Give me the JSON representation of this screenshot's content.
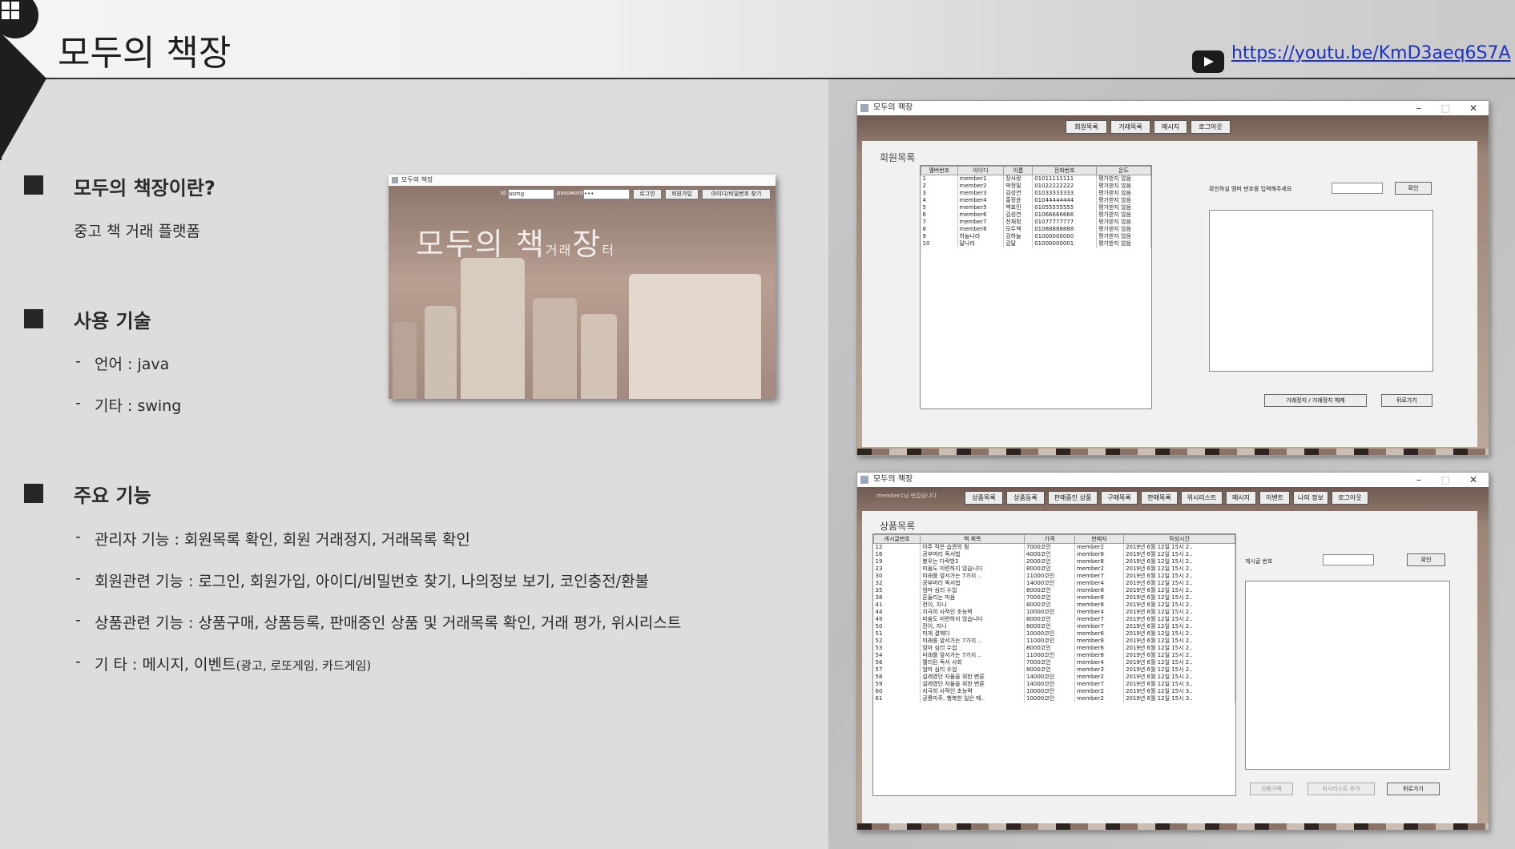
{
  "header": {
    "title": "모두의 책장",
    "youtube_link": "https://youtu.be/KmD3aeq6S7A"
  },
  "sections": {
    "about": {
      "title": "모두의 책장이란?",
      "desc": "중고 책 거래 플랫폼"
    },
    "tech": {
      "title": "사용 기술",
      "items": [
        "언어 : java",
        "기타 : swing"
      ]
    },
    "features": {
      "title": "주요 기능",
      "items": [
        "관리자 기능 : 회원목록 확인, 회원 거래정지, 거래목록 확인",
        "회원관련 기능 : 로그인, 회원가입, 아이디/비밀번호 찾기, 나의정보 보기, 코인충전/환불",
        "상품관련 기능 : 상품구매, 상품등록, 판매중인 상품 및 거래목록 확인, 거래 평가, 위시리스트"
      ],
      "etc_main": "기 타 : 메시지, 이벤트",
      "etc_small": "(광고, 로또게임, 카드게임)"
    }
  },
  "login_window": {
    "window_title": "모두의 책장",
    "id_label": "id",
    "id_value": "asmg",
    "pw_label": "password",
    "pw_value": "•••",
    "login_btn": "로그인",
    "signup_btn": "회원가입",
    "find_btn": "아이디/비밀번호 찾기",
    "title_main": "모두의 책",
    "title_small1": "거래",
    "title_main2": "장",
    "title_small2": "터"
  },
  "admin_window": {
    "window_title": "모두의 책장",
    "buttons": [
      "회원목록",
      "거래목록",
      "메시지",
      "로그아웃"
    ],
    "panel_title": "회원목록",
    "columns": [
      "멤버번호",
      "아이디",
      "이름",
      "전화번호",
      "온도"
    ],
    "rows": [
      [
        "1",
        "member1",
        "장사랑",
        "01011111111",
        "평가받지 않음"
      ],
      [
        "2",
        "member2",
        "박정필",
        "01022222222",
        "평가받지 않음"
      ],
      [
        "3",
        "member3",
        "김성연",
        "01033333333",
        "평가받지 않음"
      ],
      [
        "4",
        "member4",
        "홍정윤",
        "01044444444",
        "평가받지 않음"
      ],
      [
        "5",
        "member5",
        "백효민",
        "01055555555",
        "평가받지 않음"
      ],
      [
        "6",
        "member6",
        "김성연",
        "01066666666",
        "평가받지 않음"
      ],
      [
        "7",
        "member7",
        "전재정",
        "01077777777",
        "평가받지 않음"
      ],
      [
        "8",
        "member8",
        "모두책",
        "01088888888",
        "평가받지 않음"
      ],
      [
        "9",
        "하늘나라",
        "김하늘",
        "01000000000",
        "평가받지 않음"
      ],
      [
        "10",
        "달나라",
        "김달",
        "01000000001",
        "평가받지 않음"
      ]
    ],
    "input_label": "확인하실 멤버 번호를 입력해주세요",
    "confirm_btn": "확인",
    "suspend_btn": "거래정지 / 거래정지 해제",
    "back_btn": "뒤로가기"
  },
  "product_window": {
    "window_title": "모두의 책장",
    "welcome": "member1님 반갑습니다",
    "buttons": [
      "상품목록",
      "상품등록",
      "판매중인 상품",
      "구매목록",
      "판매목록",
      "위시리스트",
      "메시지",
      "이벤트",
      "나의 정보",
      "로그아웃"
    ],
    "panel_title": "상품목록",
    "columns": [
      "게시글번호",
      "책 제목",
      "가격",
      "판매자",
      "작성시간"
    ],
    "rows": [
      [
        "12",
        "아주 작은 습관의 힘",
        "7000코인",
        "member2",
        "2019년 6월 12일 15시 2.."
      ],
      [
        "16",
        "공부머리 독서법",
        "4000코인",
        "member8",
        "2019년 6월 12일 15시 2.."
      ],
      [
        "19",
        "봉우는 다락방2",
        "2000코인",
        "member8",
        "2019년 6월 12일 15시 2.."
      ],
      [
        "23",
        "미움도 미련하지 않습니다",
        "8000코인",
        "member2",
        "2019년 6월 12일 15시 2.."
      ],
      [
        "30",
        "미래를 앞서가는 7가지 ..",
        "11000코인",
        "member7",
        "2019년 6월 12일 15시 2.."
      ],
      [
        "32",
        "공부머리 독서법",
        "14000코인",
        "member4",
        "2019년 6월 12일 15시 2.."
      ],
      [
        "35",
        "엄마 심리 수업",
        "8000코인",
        "member8",
        "2019년 6월 12일 15시 2.."
      ],
      [
        "38",
        "흔들리는 마음",
        "7000코인",
        "member8",
        "2019년 6월 12일 15시 2.."
      ],
      [
        "41",
        "전이, 지니",
        "8000코인",
        "member8",
        "2019년 6월 12일 15시 2.."
      ],
      [
        "44",
        "지극히 사적인 초능력",
        "10000코인",
        "member4",
        "2019년 6월 12일 15시 2.."
      ],
      [
        "49",
        "미움도 미련하지 않습니다",
        "8000코인",
        "member7",
        "2019년 6월 12일 15시 2.."
      ],
      [
        "50",
        "전이, 지니",
        "8000코인",
        "member7",
        "2019년 6월 12일 15시 2.."
      ],
      [
        "51",
        "미게 결제다",
        "10000코인",
        "member6",
        "2019년 6월 12일 15시 2.."
      ],
      [
        "52",
        "미래를 앞서가는 7가지 ..",
        "11000코인",
        "member8",
        "2019년 6월 12일 15시 2.."
      ],
      [
        "53",
        "엄마 심리 수업",
        "8000코인",
        "member6",
        "2019년 6월 12일 15시 2.."
      ],
      [
        "54",
        "미래를 앞서가는 7가지 ..",
        "11000코인",
        "member8",
        "2019년 6월 12일 15시 2.."
      ],
      [
        "56",
        "멜리된 독서 사회",
        "7000코인",
        "member4",
        "2019년 6월 12일 15시 2.."
      ],
      [
        "57",
        "엄마 심리 수업",
        "8000코인",
        "member3",
        "2019년 6월 12일 15시 2.."
      ],
      [
        "58",
        "설레였던 자들을 위한 변론",
        "14000코인",
        "member2",
        "2019년 6월 12일 15시 2.."
      ],
      [
        "59",
        "설레였던 자들을 위한 변론",
        "14000코인",
        "member7",
        "2019년 6월 12일 15시 3.."
      ],
      [
        "60",
        "지극히 사적인 초능력",
        "10000코인",
        "member2",
        "2019년 6월 12일 15시 3.."
      ],
      [
        "61",
        "공룡미주, 행복한 일은 매..",
        "10000코인",
        "member2",
        "2019년 6월 12일 15시 3.."
      ]
    ],
    "input_label": "게시글 번호",
    "confirm_btn": "확인",
    "buy_btn": "상품구매",
    "wish_btn": "위시리스트 추가",
    "back_btn": "뒤로가기"
  }
}
